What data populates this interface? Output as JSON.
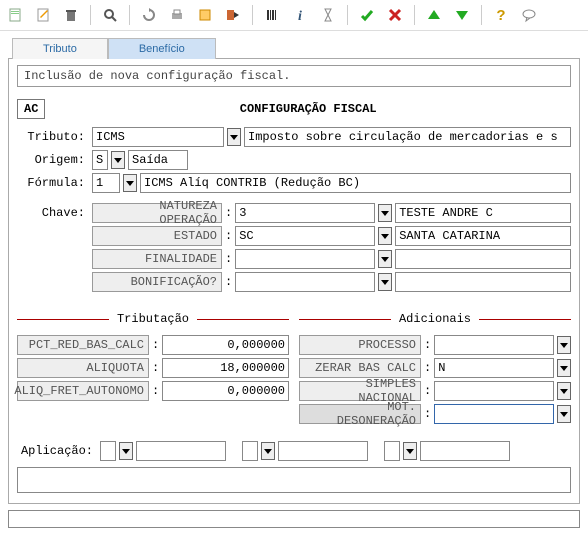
{
  "toolbar": {
    "buttons": [
      "new",
      "edit",
      "delete",
      "search",
      "refresh",
      "print",
      "export",
      "exit",
      "first",
      "info",
      "timer",
      "ok",
      "cancel",
      "up",
      "down",
      "help",
      "comment"
    ]
  },
  "tabs": {
    "tributo": "Tributo",
    "beneficio": "Benefício",
    "active": "beneficio"
  },
  "desc": "Inclusão de nova configuração fiscal.",
  "ac_label": "AC",
  "title": "CONFIGURAÇÃO FISCAL",
  "form": {
    "tributo_label": "Tributo:",
    "tributo_value": "ICMS",
    "tributo_desc": "Imposto sobre circulação de mercadorias e s",
    "origem_label": "Origem:",
    "origem_code": "S",
    "origem_value": "Saída",
    "formula_label": "Fórmula:",
    "formula_code": "1",
    "formula_desc": "ICMS Alíq CONTRIB (Redução BC)"
  },
  "chave": {
    "label": "Chave:",
    "rows": [
      {
        "name": "NATUREZA OPERAÇÃO",
        "code": "3",
        "desc": "TESTE ANDRE C"
      },
      {
        "name": "ESTADO",
        "code": "SC",
        "desc": "SANTA CATARINA"
      },
      {
        "name": "FINALIDADE",
        "code": "",
        "desc": ""
      },
      {
        "name": "BONIFICAÇÃO?",
        "code": "",
        "desc": ""
      }
    ]
  },
  "tributacao": {
    "legend": "Tributação",
    "rows": [
      {
        "name": "PCT_RED_BAS_CALC",
        "value": "0,000000"
      },
      {
        "name": "ALIQUOTA",
        "value": "18,000000"
      },
      {
        "name": "ALIQ_FRET_AUTONOMO",
        "value": "0,000000"
      }
    ]
  },
  "adicionais": {
    "legend": "Adicionais",
    "rows": [
      {
        "name": "PROCESSO",
        "value": ""
      },
      {
        "name": "ZERAR BAS CALC",
        "value": "N"
      },
      {
        "name": "SIMPLES NACIONAL",
        "value": ""
      },
      {
        "name": "MOT. DESONERAÇÃO",
        "value": ""
      }
    ]
  },
  "aplicacao": {
    "label": "Aplicação:"
  }
}
